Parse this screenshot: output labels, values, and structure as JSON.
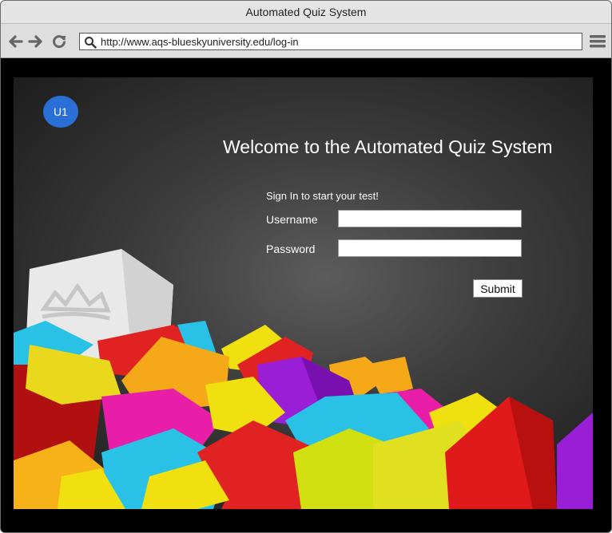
{
  "window": {
    "title": "Automated Quiz System"
  },
  "toolbar": {
    "url": "http://www.aqs-blueskyuniversity.edu/log-in",
    "back_icon": "arrow-left-icon",
    "forward_icon": "arrow-right-icon",
    "reload_icon": "reload-icon",
    "menu_icon": "hamburger-menu-icon"
  },
  "page": {
    "avatar_initials": "U1",
    "heading": "Welcome to the Automated Quiz System",
    "signin_hint": "Sign In to start your test!",
    "username_label": "Username",
    "password_label": "Password",
    "username_value": "",
    "password_value": "",
    "submit_label": "Submit"
  },
  "colors": {
    "avatar": "#2a6fd6",
    "background": "#3c3c3c"
  }
}
